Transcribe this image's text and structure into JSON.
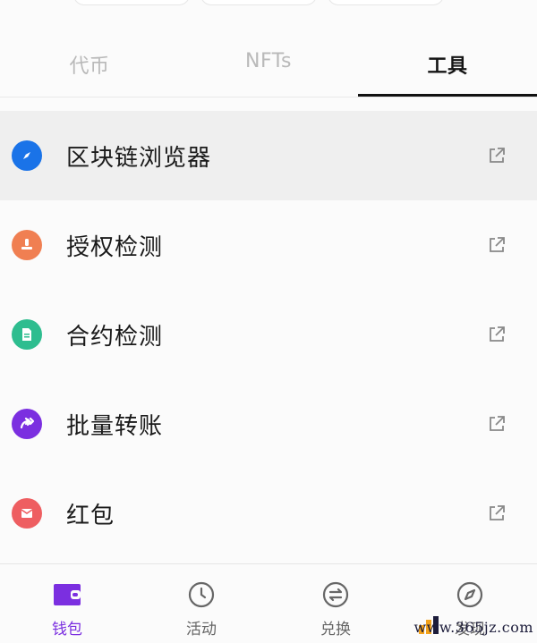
{
  "tabs": [
    {
      "label": "代币"
    },
    {
      "label": "NFTs"
    },
    {
      "label": "工具",
      "active": true
    }
  ],
  "tools": [
    {
      "label": "区块链浏览器",
      "icon": "compass-icon",
      "color": "#1a73e8"
    },
    {
      "label": "授权检测",
      "icon": "stamp-icon",
      "color": "#f07f52"
    },
    {
      "label": "合约检测",
      "icon": "document-icon",
      "color": "#2ebd8f"
    },
    {
      "label": "批量转账",
      "icon": "forward-arrows-icon",
      "color": "#7b2fe0"
    },
    {
      "label": "红包",
      "icon": "envelope-icon",
      "color": "#ee5e61"
    }
  ],
  "nav": [
    {
      "label": "钱包",
      "icon": "wallet-icon",
      "active": true
    },
    {
      "label": "活动",
      "icon": "clock-icon"
    },
    {
      "label": "兑换",
      "icon": "swap-icon"
    },
    {
      "label": "发现",
      "icon": "compass-icon"
    }
  ],
  "watermark": "www.365jz.com",
  "colors": {
    "accent": "#7b2fe0",
    "text": "#1a1a1a",
    "muted": "#b9b9b9"
  }
}
